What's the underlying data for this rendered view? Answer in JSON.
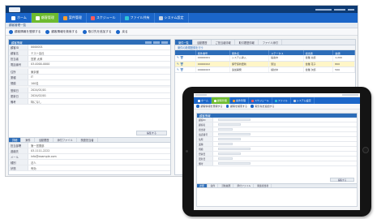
{
  "desktop": {
    "nav": [
      {
        "label": "ホーム",
        "icon": "home-icon",
        "color": "#ffffff",
        "active": false
      },
      {
        "label": "顧客管理",
        "icon": "customer-icon",
        "color": "#ffffff",
        "active": true
      },
      {
        "label": "案件管理",
        "icon": "deal-icon",
        "color": "#ff9d2e",
        "active": false
      },
      {
        "label": "スケジュール",
        "icon": "calendar-icon",
        "color": "#ff5a5a",
        "active": false
      },
      {
        "label": "ファイル共有",
        "icon": "file-icon",
        "color": "#2ec5d6",
        "active": false
      },
      {
        "label": "システム設定",
        "icon": "settings-icon",
        "color": "#c7d3e3",
        "active": false
      }
    ],
    "subtitle": "顧客管理一覧",
    "actions": [
      "顧客情報を登録する",
      "顧客情報を検索する",
      "取引先を追加する",
      "戻る"
    ],
    "left_head": "顧客情報",
    "fields": [
      {
        "label": "顧客ID",
        "value": "0000001"
      },
      {
        "label": "顧客名",
        "value": "テスト会社"
      },
      {
        "label": "担当者",
        "value": "営業 太郎"
      },
      {
        "label": "電話番号",
        "value": "03-0000-0000"
      },
      {
        "label": "住所",
        "value": "東京都"
      },
      {
        "label": "業種",
        "value": "IT"
      },
      {
        "label": "規模",
        "value": "100名"
      },
      {
        "label": "登録日",
        "value": "2024/01/01"
      },
      {
        "label": "更新日",
        "value": "2024/02/01"
      },
      {
        "label": "備考",
        "value": "特になし"
      }
    ],
    "edit_button": "編集する",
    "subtabs": [
      "詳細",
      "案件",
      "活動履歴",
      "添付ファイル",
      "関連担当者"
    ],
    "sub_fields": [
      {
        "label": "担当部署",
        "value": "第一営業部"
      },
      {
        "label": "連絡先",
        "value": "03-1111-2222"
      },
      {
        "label": "メール",
        "value": "info@example.com"
      },
      {
        "label": "種別",
        "value": "法人"
      },
      {
        "label": "状態",
        "value": "有効"
      }
    ],
    "right_tabs": [
      "案件一覧",
      "活動履歴",
      "ご担当者情報",
      "取引履歴情報",
      "ファイル添付"
    ],
    "right_bar": "案件の新規登録を行う",
    "table_headers": [
      "",
      "案件番号",
      "案件名",
      "ステータス",
      "担当者",
      "金額"
    ],
    "table_rows": [
      [
        "",
        "00000001",
        "システム導入",
        "提案中",
        "営業 太郎",
        "1,200"
      ],
      [
        "",
        "00000002",
        "保守契約更新",
        "受注",
        "営業 花子",
        "800"
      ],
      [
        "",
        "00000003",
        "追加開発",
        "検討中",
        "営業 次郎",
        "500"
      ]
    ]
  },
  "tablet": {
    "nav": [
      "ホーム",
      "顧客管理",
      "案件管理",
      "スケジュール",
      "ファイル",
      "システム設定"
    ],
    "actions": [
      "顧客情報を登録する",
      "顧客を検索する",
      "取引先を追加する"
    ],
    "head": "顧客情報",
    "fields": [
      "顧客ID",
      "顧客名",
      "担当者",
      "電話番号",
      "住所",
      "業種",
      "規模",
      "登録日",
      "更新日",
      "備考"
    ],
    "button": "編集する",
    "subtabs": [
      "詳細",
      "案件",
      "活動履歴",
      "添付ファイル",
      "関連担当者"
    ]
  },
  "colors": {
    "navy": "#0d3a72",
    "nav_blue": "#1b66c9",
    "active_green": "#6dbb2f",
    "header_blue": "#2d6db8"
  }
}
